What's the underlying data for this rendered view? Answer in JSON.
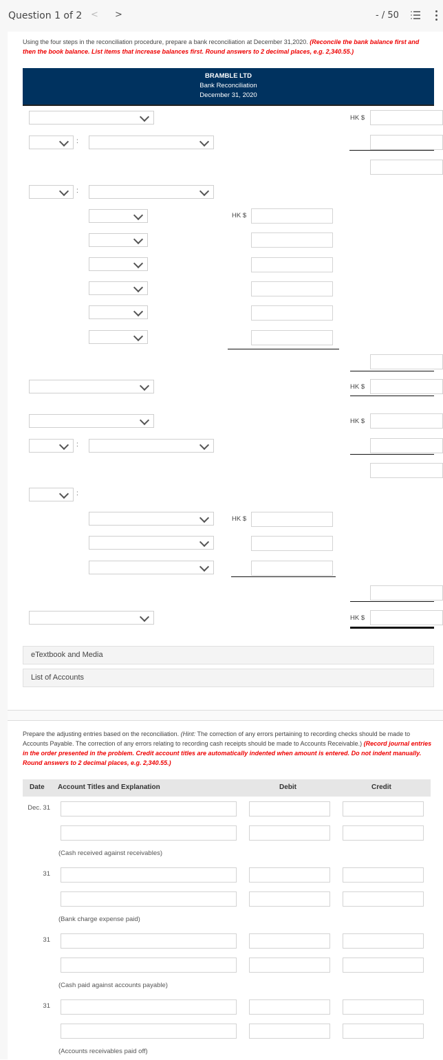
{
  "topbar": {
    "question_label": "Question 1 of 2",
    "prev_glyph": "<",
    "next_glyph": ">",
    "score": "- / 50"
  },
  "part1": {
    "instruction_plain": "Using the four steps in the reconciliation procedure, prepare a bank reconciliation at December 31,2020. ",
    "instruction_red": "(Reconcile the bank balance first and then the book balance. List items that increase balances first. Round answers to 2 decimal places, e.g. 2,340.55.)",
    "header": {
      "company": "BRAMBLE LTD",
      "statement": "Bank Reconciliation",
      "date": "December 31, 2020"
    },
    "currency_label": "HK $",
    "colon": ":"
  },
  "resources": {
    "etextbook": "eTextbook and Media",
    "list_of_accounts": "List of Accounts"
  },
  "part2": {
    "instruction_plain_1": "Prepare the adjusting entries based on the reconciliation. ",
    "instruction_hint_label": "(Hint:",
    "instruction_plain_2": " The correction of any errors pertaining to recording checks should be made to Accounts Payable. The correction of any errors relating to recording cash receipts should be made to Accounts Receivable.) ",
    "instruction_red": "(Record journal entries in the order presented in the problem. Credit account titles are automatically indented when amount is entered. Do not indent manually. Round answers to 2 decimal places, e.g. 2,340.55.)",
    "table_headers": {
      "date": "Date",
      "account": "Account Titles and Explanation",
      "debit": "Debit",
      "credit": "Credit"
    },
    "entries": [
      {
        "date": "Dec. 31",
        "explanation": "(Cash received against receivables)"
      },
      {
        "date": "31",
        "explanation": "(Bank charge expense paid)"
      },
      {
        "date": "31",
        "explanation": "(Cash paid against accounts payable)"
      },
      {
        "date": "31",
        "explanation": "(Accounts receivables paid off)"
      }
    ]
  }
}
